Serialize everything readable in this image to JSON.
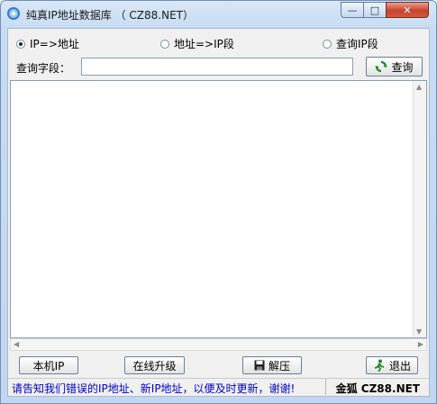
{
  "window": {
    "title": "纯真IP地址数据库 （ CZ88.NET）",
    "controls": {
      "minimize": "—",
      "maximize": "□",
      "close": "✕"
    }
  },
  "search_modes": [
    {
      "label": "IP=>地址",
      "checked": true
    },
    {
      "label": "地址=>IP段",
      "checked": false
    },
    {
      "label": "查询IP段",
      "checked": false
    }
  ],
  "query": {
    "label": "查询字段：",
    "value": "",
    "button_label": "查询"
  },
  "buttons": {
    "local_ip": "本机IP",
    "online_upgrade": "在线升级",
    "unzip": "解压",
    "exit": "退出"
  },
  "status": {
    "message": "请告知我们错误的IP地址、新IP地址，以便及时更新，谢谢!",
    "credit": "金狐 CZ88.NET"
  },
  "colors": {
    "status_text": "#0000cc",
    "refresh_icon": "#1f8a2c",
    "close_button": "#c7432b"
  }
}
